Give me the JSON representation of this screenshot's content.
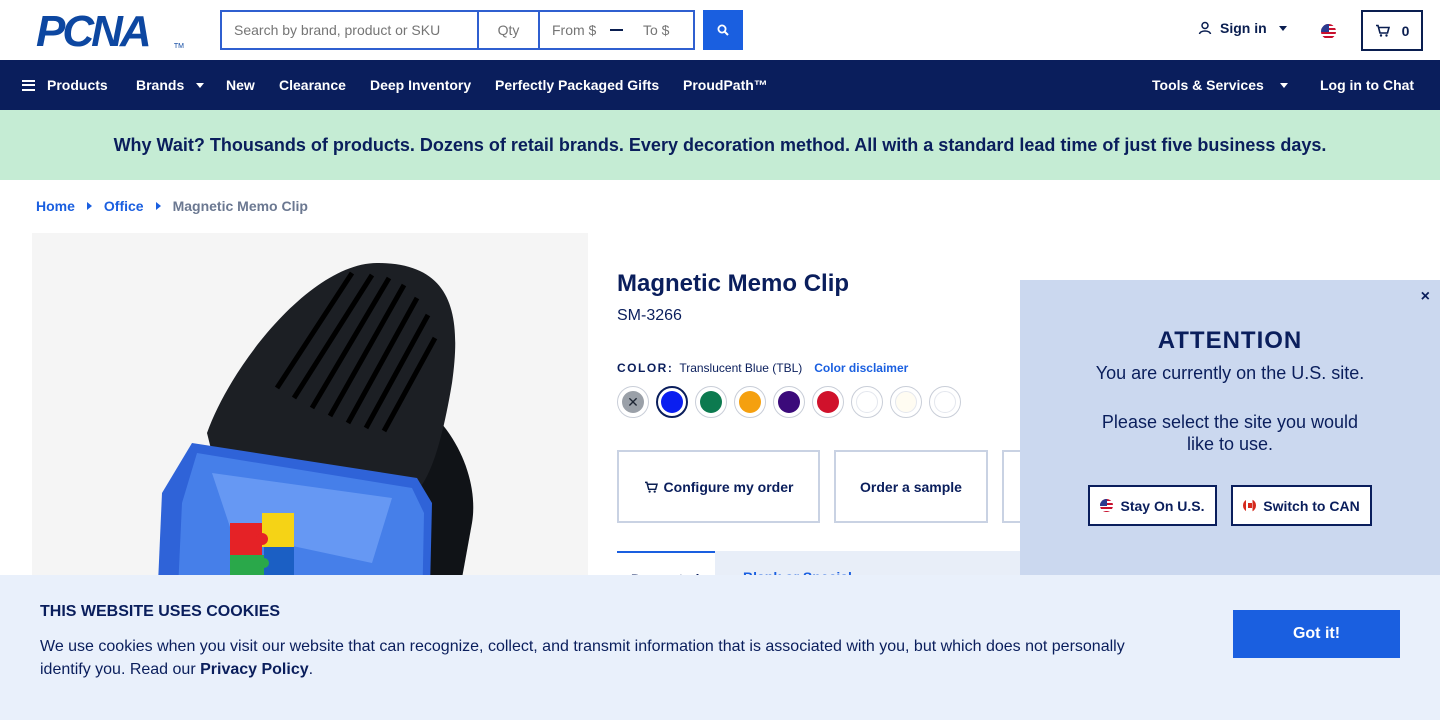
{
  "header": {
    "logo_text": "PCNA",
    "logo_tm": "TM",
    "search_placeholder": "Search by brand, product or SKU",
    "qty_placeholder": "Qty",
    "from_placeholder": "From $",
    "to_placeholder": "To $",
    "signin_label": "Sign in",
    "cart_count": "0"
  },
  "nav": {
    "products": "Products",
    "brands": "Brands",
    "new": "New",
    "clearance": "Clearance",
    "deep_inventory": "Deep Inventory",
    "gifts": "Perfectly Packaged Gifts",
    "proudpath": "ProudPath™",
    "tools": "Tools & Services",
    "chat": "Log in to Chat"
  },
  "promo": "Why Wait? Thousands of products. Dozens of retail brands. Every decoration method. All with a standard lead time of just five business days.",
  "breadcrumb": [
    "Home",
    "Office",
    "Magnetic Memo Clip"
  ],
  "product": {
    "title": "Magnetic Memo Clip",
    "sku": "SM-3266",
    "color_key": "COLOR:",
    "color_value": "Translucent Blue (TBL)",
    "color_disclaimer": "Color disclaimer",
    "swatches": [
      {
        "name": "gray",
        "color": "#9aa0a8",
        "selected": false
      },
      {
        "name": "blue",
        "color": "#0a1ef0",
        "selected": true
      },
      {
        "name": "green",
        "color": "#0c7a4f",
        "selected": false
      },
      {
        "name": "orange",
        "color": "#f5a00f",
        "selected": false
      },
      {
        "name": "purple",
        "color": "#3b0a7a",
        "selected": false
      },
      {
        "name": "red",
        "color": "#d0112b",
        "selected": false
      },
      {
        "name": "white",
        "color": "#ffffff",
        "selected": false
      },
      {
        "name": "ivory",
        "color": "#fffcf2",
        "selected": false
      },
      {
        "name": "clear",
        "color": "#ffffff",
        "selected": false
      }
    ],
    "configure_label": "Configure my order",
    "sample_label": "Order a sample",
    "tab_active": "Decorated",
    "tab_other": "Blank or Special"
  },
  "attention": {
    "title": "ATTENTION",
    "line1": "You are currently on the U.S. site.",
    "line2": "Please select the site you would",
    "line3": "like to use.",
    "stay_label": "Stay On U.S.",
    "switch_label": "Switch to CAN",
    "close": "×"
  },
  "cookie": {
    "title": "THIS WEBSITE USES COOKIES",
    "text": "We use cookies when you visit our website that can recognize, collect, and transmit information that is associated with you, but which does not personally identify you. Read our ",
    "link": "Privacy Policy",
    "end": ".",
    "button": "Got it!"
  }
}
